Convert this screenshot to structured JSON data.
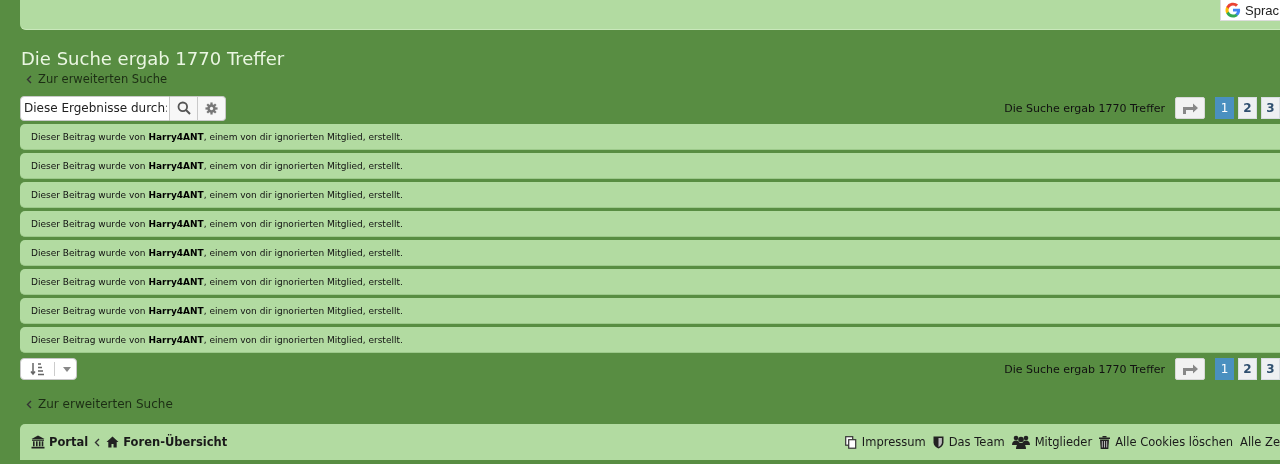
{
  "translate_widget": {
    "label": "Sprac"
  },
  "title": "Die Suche ergab 1770 Treffer",
  "back_link_top": "Zur erweiterten Suche",
  "search": {
    "placeholder": "Diese Ergebnisse durch:"
  },
  "pagination_top": {
    "summary": "Die Suche ergab 1770 Treffer",
    "pages": [
      {
        "label": "1",
        "selected": true
      },
      {
        "label": "2",
        "selected": false
      },
      {
        "label": "3",
        "selected": false
      }
    ]
  },
  "results": [
    {
      "text": "Dieser Beitrag wurde von **Harry4ANT**, einem von dir ignorierten Mitglied, erstellt."
    },
    {
      "text": "Dieser Beitrag wurde von **Harry4ANT**, einem von dir ignorierten Mitglied, erstellt."
    },
    {
      "text": "Dieser Beitrag wurde von **Harry4ANT**, einem von dir ignorierten Mitglied, erstellt."
    },
    {
      "text": "Dieser Beitrag wurde von **Harry4ANT**, einem von dir ignorierten Mitglied, erstellt."
    },
    {
      "text": "Dieser Beitrag wurde von **Harry4ANT**, einem von dir ignorierten Mitglied, erstellt."
    },
    {
      "text": "Dieser Beitrag wurde von **Harry4ANT**, einem von dir ignorierten Mitglied, erstellt."
    },
    {
      "text": "Dieser Beitrag wurde von **Harry4ANT**, einem von dir ignorierten Mitglied, erstellt."
    },
    {
      "text": "Dieser Beitrag wurde von **Harry4ANT**, einem von dir ignorierten Mitglied, erstellt."
    }
  ],
  "pagination_bottom": {
    "summary": "Die Suche ergab 1770 Treffer",
    "pages": [
      {
        "label": "1",
        "selected": true
      },
      {
        "label": "2",
        "selected": false
      },
      {
        "label": "3",
        "selected": false
      }
    ]
  },
  "back_link_bottom": "Zur erweiterten Suche",
  "breadcrumbs": [
    {
      "kind": "portal",
      "label": "Portal"
    },
    {
      "kind": "home",
      "label": "Foren-Übersicht"
    }
  ],
  "footer_links": [
    {
      "kind": "impressum",
      "label": "Impressum"
    },
    {
      "kind": "team",
      "label": "Das Team"
    },
    {
      "kind": "members",
      "label": "Mitglieder"
    },
    {
      "kind": "cookies",
      "label": "Alle Cookies löschen"
    },
    {
      "kind": "plain",
      "label": "Alle Ze"
    }
  ]
}
